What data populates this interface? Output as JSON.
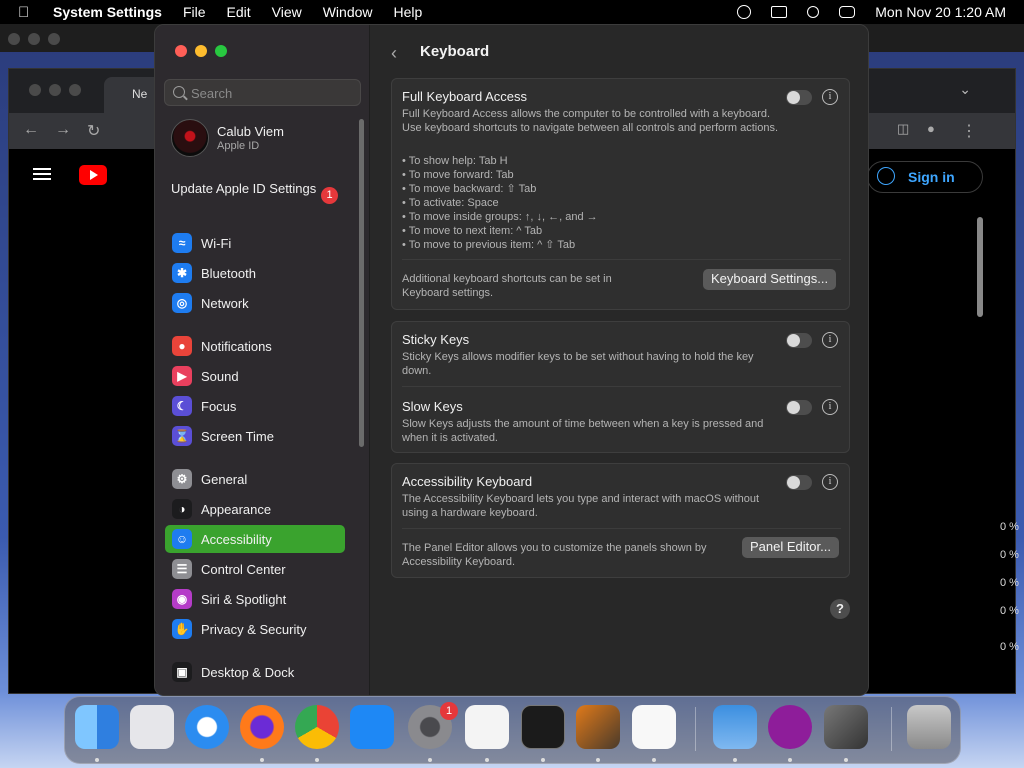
{
  "menubar": {
    "app": "System Settings",
    "items": [
      "File",
      "Edit",
      "View",
      "Window",
      "Help"
    ],
    "clock": "Mon Nov 20  1:20 AM"
  },
  "browser": {
    "tab_label": "Ne",
    "signin_label": "Sign in",
    "percent_labels": [
      "0 %",
      "0 %",
      "0 %",
      "0 %",
      "0 %"
    ]
  },
  "sidebar": {
    "search_placeholder": "Search",
    "profile": {
      "name": "Calub Viem",
      "sub": "Apple ID"
    },
    "update": {
      "label": "Update Apple ID Settings",
      "badge": "1"
    },
    "items": [
      {
        "label": "Wi-Fi",
        "icon": "wifi-icon",
        "color": "#1e7cf0"
      },
      {
        "label": "Bluetooth",
        "icon": "bluetooth-icon",
        "color": "#1e7cf0"
      },
      {
        "label": "Network",
        "icon": "globe-icon",
        "color": "#1e7cf0"
      },
      {
        "label": "Notifications",
        "icon": "bell-icon",
        "color": "#e9443a"
      },
      {
        "label": "Sound",
        "icon": "speaker-icon",
        "color": "#e9405e"
      },
      {
        "label": "Focus",
        "icon": "moon-icon",
        "color": "#5b4fd6"
      },
      {
        "label": "Screen Time",
        "icon": "hourglass-icon",
        "color": "#5b4fd6"
      },
      {
        "label": "General",
        "icon": "gear-icon",
        "color": "#8e8e93"
      },
      {
        "label": "Appearance",
        "icon": "appearance-icon",
        "color": "#1c1c1e"
      },
      {
        "label": "Accessibility",
        "icon": "accessibility-icon",
        "color": "#1e7cf0"
      },
      {
        "label": "Control Center",
        "icon": "control-center-icon",
        "color": "#8e8e93"
      },
      {
        "label": "Siri & Spotlight",
        "icon": "siri-icon",
        "color": "#b53cc8"
      },
      {
        "label": "Privacy & Security",
        "icon": "hand-icon",
        "color": "#1e7cf0"
      },
      {
        "label": "Desktop & Dock",
        "icon": "dock-icon",
        "color": "#1c1c1e"
      }
    ]
  },
  "main": {
    "title": "Keyboard",
    "full_keyboard_access": {
      "title": "Full Keyboard Access",
      "desc": "Full Keyboard Access allows the computer to be controlled with a keyboard. Use keyboard shortcuts to navigate between all controls and perform actions.",
      "tips": [
        "• To show help: Tab H",
        "• To move forward: Tab",
        "• To move backward: ⇧ Tab",
        "• To activate: Space",
        "• To move inside groups: ↑, ↓, ←, and →",
        "• To move to next item: ^ Tab",
        "• To move to previous item: ^ ⇧ Tab"
      ],
      "more": "Additional keyboard shortcuts can be set in Keyboard settings.",
      "button": "Keyboard Settings..."
    },
    "sticky_keys": {
      "title": "Sticky Keys",
      "desc": "Sticky Keys allows modifier keys to be set without having to hold the key down."
    },
    "slow_keys": {
      "title": "Slow Keys",
      "desc": "Slow Keys adjusts the amount of time between when a key is pressed and when it is activated."
    },
    "accessibility_keyboard": {
      "title": "Accessibility Keyboard",
      "desc": "The Accessibility Keyboard lets you type and interact with macOS without using a hardware keyboard.",
      "panel_desc": "The Panel Editor allows you to customize the panels shown by Accessibility Keyboard.",
      "button": "Panel Editor..."
    },
    "help": "?",
    "info": "i"
  },
  "dock": {
    "badge": "1",
    "items": [
      {
        "name": "finder-icon",
        "color": "#3c9ef2"
      },
      {
        "name": "launchpad-icon",
        "color": "#e6e6ea"
      },
      {
        "name": "safari-icon",
        "color": "#2b8cf0"
      },
      {
        "name": "firefox-icon",
        "color": "#ff7a1a"
      },
      {
        "name": "chrome-icon",
        "color": "#e8e8e8"
      },
      {
        "name": "app-store-icon",
        "color": "#1e88f5"
      },
      {
        "name": "system-settings-icon",
        "color": "#8a8a8e"
      },
      {
        "name": "textedit-icon",
        "color": "#f4f4f4"
      },
      {
        "name": "terminal-icon",
        "color": "#1b1b1b"
      },
      {
        "name": "garageband-icon",
        "color": "#4a3a2a"
      },
      {
        "name": "vscode-icon",
        "color": "#1f8ad2"
      },
      {
        "name": "weather-icon",
        "color": "#3c8fe0"
      },
      {
        "name": "eleven-icon",
        "color": "#8e1d9a"
      },
      {
        "name": "paper-plane-icon",
        "color": "#555"
      },
      {
        "name": "trash-icon",
        "color": "#9a9a9a"
      }
    ]
  }
}
